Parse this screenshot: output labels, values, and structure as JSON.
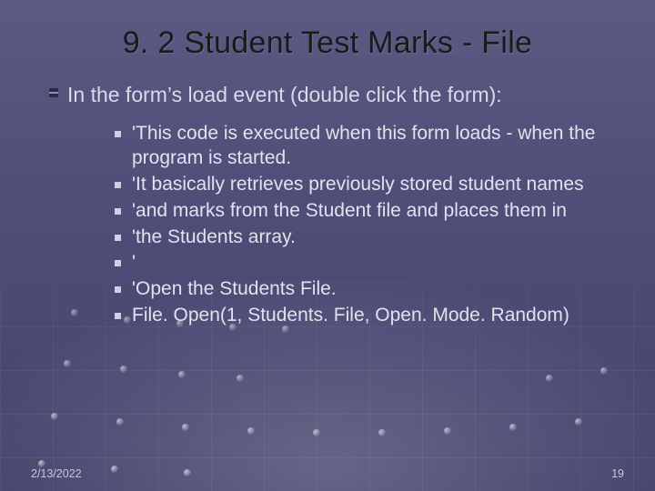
{
  "title": "9. 2 Student Test Marks - File",
  "level1": "In the form’s load event (double click the form):",
  "bullets": [
    "'This code is executed when this form loads - when the program is started.",
    "'It basically retrieves previously stored student names",
    "'and marks from the Student file and places them in",
    "'the Students array.",
    "'",
    "'Open the Students File.",
    "File. Open(1, Students. File, Open. Mode. Random)"
  ],
  "footer": {
    "date": "2/13/2022",
    "page": "19"
  }
}
